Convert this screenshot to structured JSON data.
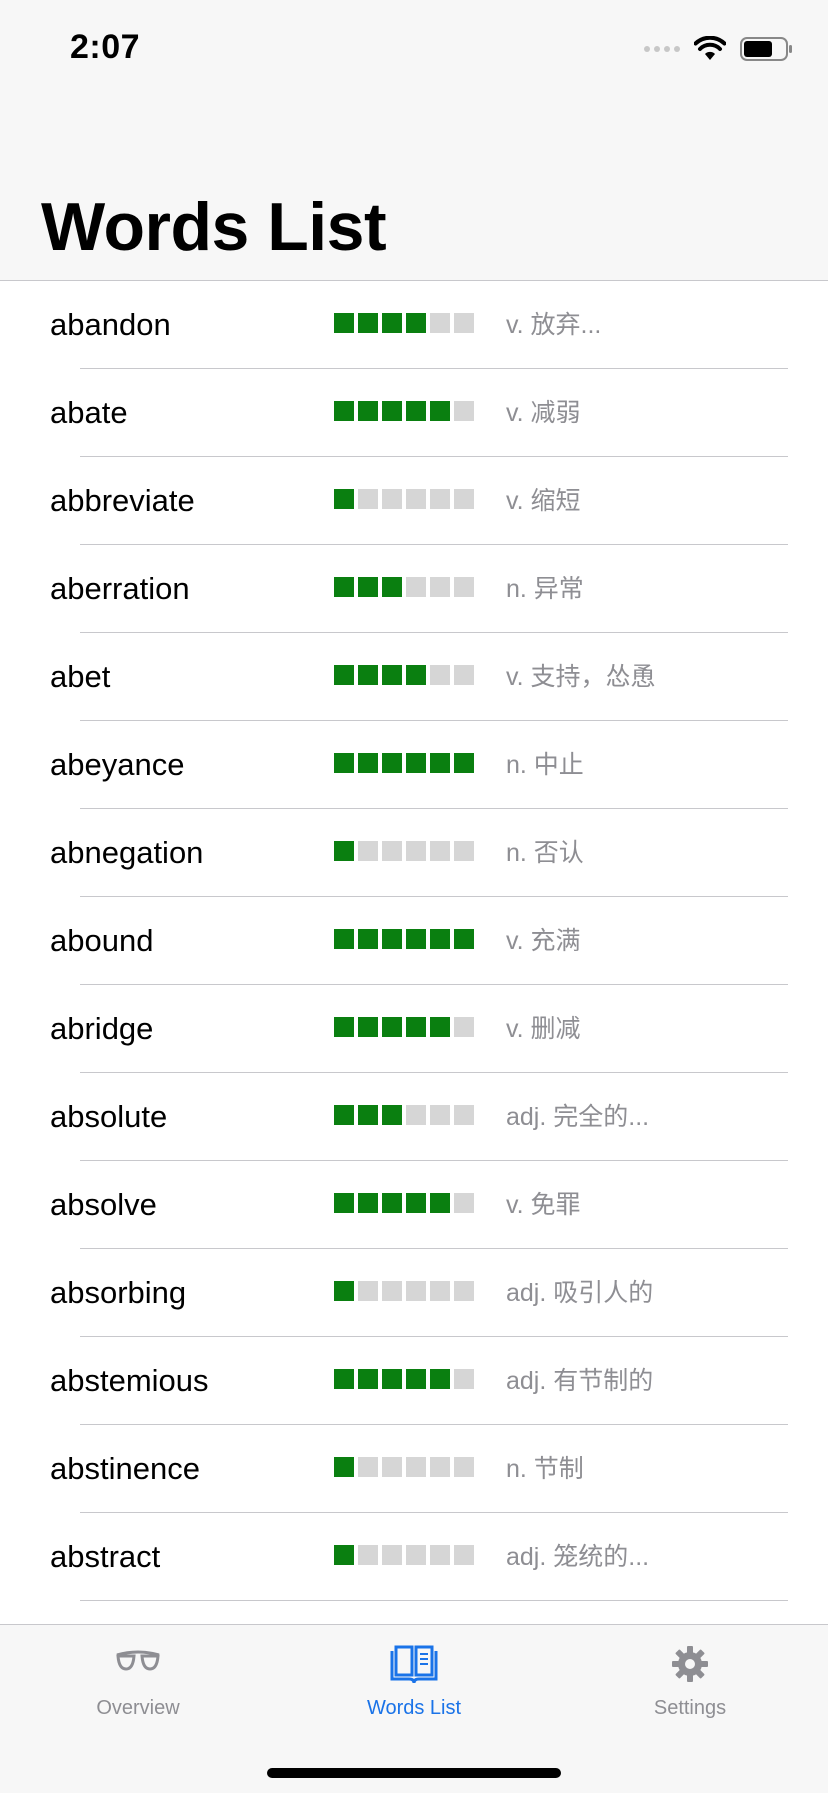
{
  "status_bar": {
    "time": "2:07"
  },
  "header": {
    "title": "Words List"
  },
  "words": [
    {
      "word": "abandon",
      "level": 4,
      "definition": "v. 放弃..."
    },
    {
      "word": "abate",
      "level": 5,
      "definition": "v. 减弱"
    },
    {
      "word": "abbreviate",
      "level": 1,
      "definition": "v. 缩短"
    },
    {
      "word": "aberration",
      "level": 3,
      "definition": "n. 异常"
    },
    {
      "word": "abet",
      "level": 4,
      "definition": "v. 支持，怂恿"
    },
    {
      "word": "abeyance",
      "level": 6,
      "definition": "n. 中止"
    },
    {
      "word": "abnegation",
      "level": 1,
      "definition": "n. 否认"
    },
    {
      "word": "abound",
      "level": 6,
      "definition": "v. 充满"
    },
    {
      "word": "abridge",
      "level": 5,
      "definition": "v. 删减"
    },
    {
      "word": "absolute",
      "level": 3,
      "definition": "adj. 完全的..."
    },
    {
      "word": "absolve",
      "level": 5,
      "definition": "v. 免罪"
    },
    {
      "word": "absorbing",
      "level": 1,
      "definition": "adj. 吸引人的"
    },
    {
      "word": "abstemious",
      "level": 5,
      "definition": "adj. 有节制的"
    },
    {
      "word": "abstinence",
      "level": 1,
      "definition": "n. 节制"
    },
    {
      "word": "abstract",
      "level": 1,
      "definition": "adj. 笼统的..."
    }
  ],
  "level_max": 6,
  "colors": {
    "level_on": "#0a7f10",
    "level_off": "#d6d6d6",
    "accent": "#1a73e8",
    "inactive": "#8e8e93"
  },
  "tabs": [
    {
      "label": "Overview",
      "icon": "glasses-icon",
      "active": false
    },
    {
      "label": "Words List",
      "icon": "book-icon",
      "active": true
    },
    {
      "label": "Settings",
      "icon": "gear-icon",
      "active": false
    }
  ]
}
